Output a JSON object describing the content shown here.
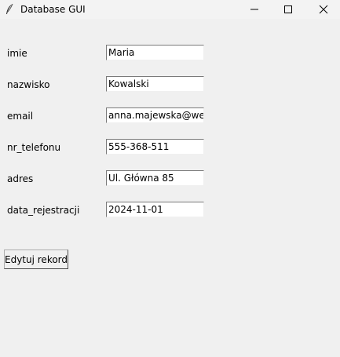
{
  "window": {
    "title": "Database GUI",
    "icon": "feather-icon",
    "controls": {
      "minimize": "minimize-icon",
      "maximize": "maximize-icon",
      "close": "close-icon"
    }
  },
  "form": {
    "fields": [
      {
        "label": "imie",
        "value": "Maria"
      },
      {
        "label": "nazwisko",
        "value": "Kowalski"
      },
      {
        "label": "email",
        "value": "anna.majewska@web.de"
      },
      {
        "label": "nr_telefonu",
        "value": "555-368-511"
      },
      {
        "label": "adres",
        "value": "Ul. Główna 85"
      },
      {
        "label": "data_rejestracji",
        "value": "2024-11-01"
      }
    ],
    "submit_label": "Edytuj rekord"
  }
}
